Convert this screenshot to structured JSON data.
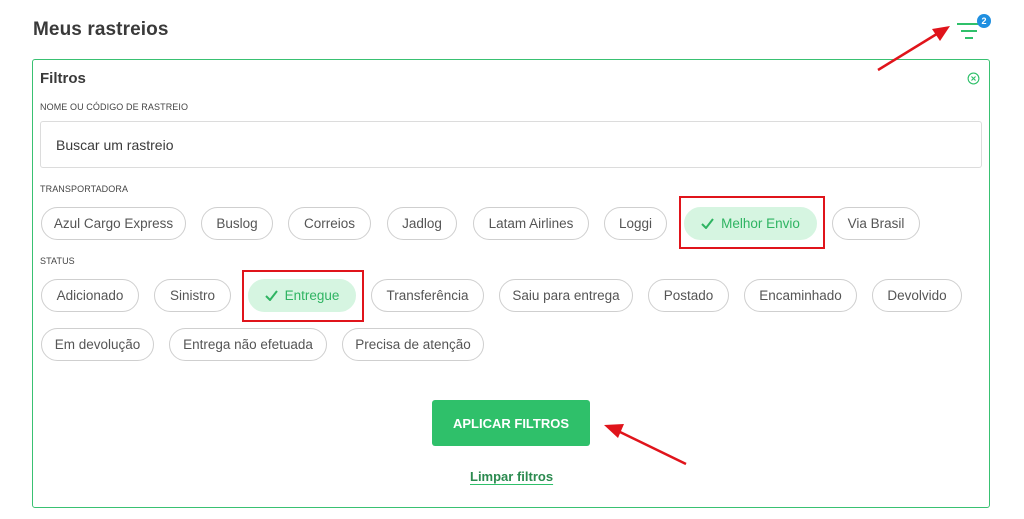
{
  "header": {
    "title": "Meus rastreios",
    "filter_badge_count": "2"
  },
  "filters": {
    "title": "Filtros",
    "search": {
      "label": "NOME OU CÓDIGO DE RASTREIO",
      "placeholder": "Buscar um rastreio",
      "value": ""
    },
    "carrier": {
      "label": "TRANSPORTADORA",
      "options": [
        {
          "label": "Azul Cargo Express",
          "selected": false
        },
        {
          "label": "Buslog",
          "selected": false
        },
        {
          "label": "Correios",
          "selected": false
        },
        {
          "label": "Jadlog",
          "selected": false
        },
        {
          "label": "Latam Airlines",
          "selected": false
        },
        {
          "label": "Loggi",
          "selected": false
        },
        {
          "label": "Melhor Envio",
          "selected": true
        },
        {
          "label": "Via Brasil",
          "selected": false
        }
      ]
    },
    "status": {
      "label": "STATUS",
      "options": [
        {
          "label": "Adicionado",
          "selected": false
        },
        {
          "label": "Sinistro",
          "selected": false
        },
        {
          "label": "Entregue",
          "selected": true
        },
        {
          "label": "Transferência",
          "selected": false
        },
        {
          "label": "Saiu para entrega",
          "selected": false
        },
        {
          "label": "Postado",
          "selected": false
        },
        {
          "label": "Encaminhado",
          "selected": false
        },
        {
          "label": "Devolvido",
          "selected": false
        },
        {
          "label": "Em devolução",
          "selected": false
        },
        {
          "label": "Entrega não efetuada",
          "selected": false
        },
        {
          "label": "Precisa de atenção",
          "selected": false
        }
      ]
    },
    "apply_label": "APLICAR FILTROS",
    "clear_label": "Limpar filtros"
  },
  "colors": {
    "accent": "#2fc06a",
    "selected_bg": "#d6f5e1",
    "badge": "#1f8fe0",
    "annotation": "#e0141b"
  },
  "icons": [
    "filter-icon",
    "close-circle-icon",
    "check-icon",
    "arrow-annotation"
  ]
}
